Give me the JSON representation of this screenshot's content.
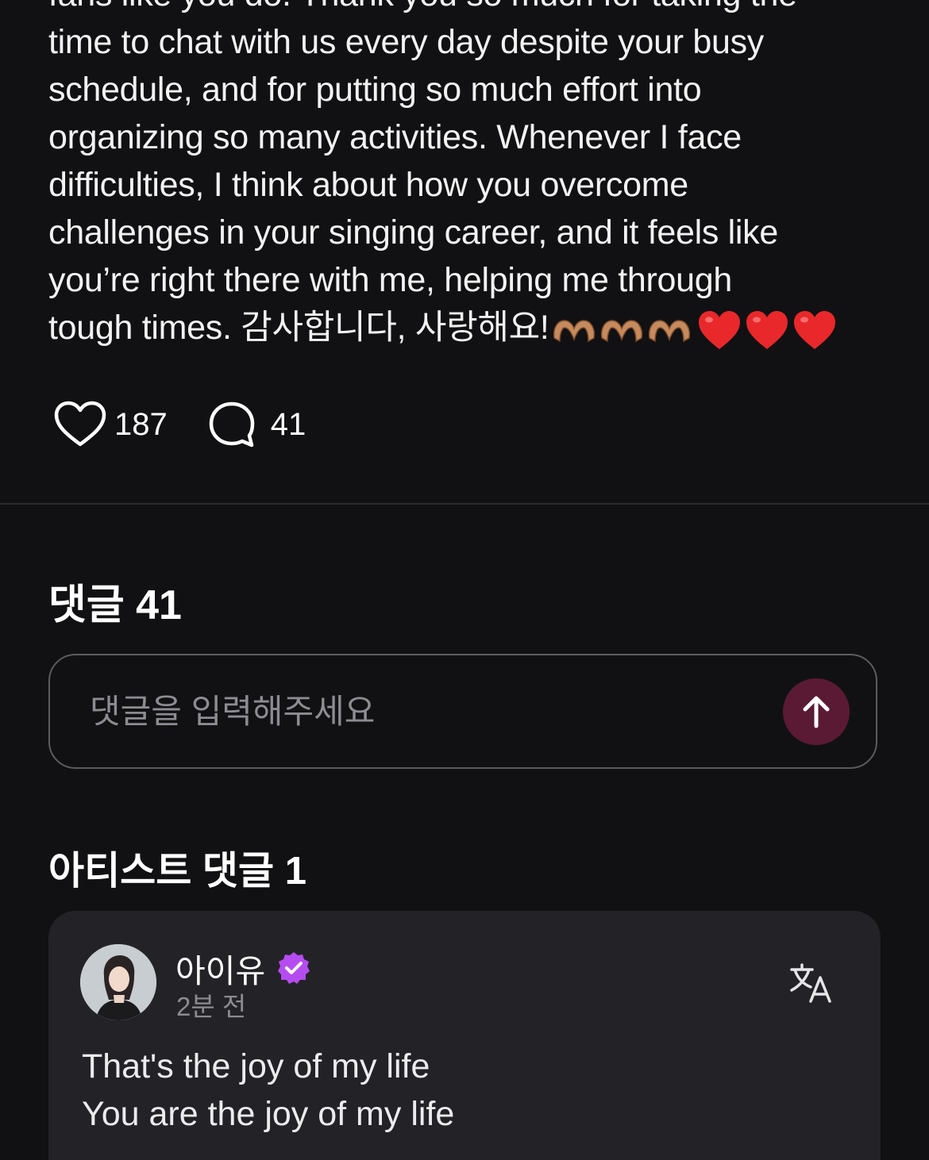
{
  "post": {
    "lines": [
      "fans like you do. Thank you so much for taking the",
      "time to chat with us every day despite your busy",
      "schedule, and for putting so much effort into",
      "organizing so many activities. Whenever I face",
      "difficulties, I think about how you overcome",
      "challenges in your singing career, and it feels like",
      "you’re right there with me, helping me through",
      "tough times. 감사합니다, 사랑해요!"
    ],
    "emojis": [
      "heart-hands",
      "heart-hands",
      "heart-hands",
      "red-heart",
      "red-heart",
      "red-heart"
    ],
    "likes": "187",
    "comments": "41"
  },
  "comments_section": {
    "title": "댓글 41",
    "input_placeholder": "댓글을 입력해주세요",
    "send_icon": "arrow-up-icon",
    "send_color": "#5a1a33"
  },
  "artist_section": {
    "title": "아티스트 댓글 1",
    "comment": {
      "name": "아이유",
      "verified_color": "#b54cf0",
      "time": "2분 전",
      "lines": [
        "That's the joy of my life",
        "You are the joy of my life"
      ],
      "translate_icon": "translate-icon"
    }
  },
  "colors": {
    "background": "#111113",
    "card": "#232327",
    "muted_text": "#8b8b90"
  }
}
